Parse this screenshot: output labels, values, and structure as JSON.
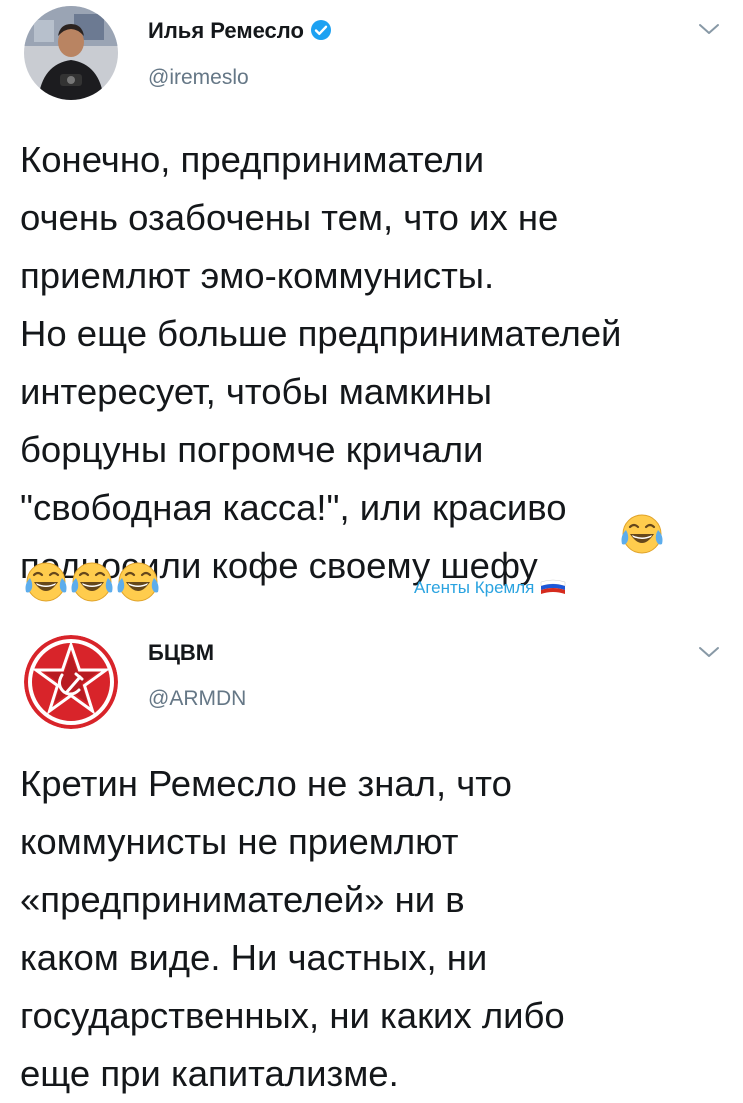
{
  "tweet1": {
    "author_name": "Илья Ремесло",
    "author_handle": "@iremeslo",
    "text": "Конечно, предприниматели\nочень озабочены тем, что их не\nприемлют эмо-коммунисты.\nНо еще больше предпринимателей\nинтересует, чтобы мамкины\nборцуны погромче кричали\n\"свободная касса!\", или красиво\nподносили кофе своему шефу",
    "emoji": "face-with-tears-of-joy",
    "emoji_count": 4,
    "signature": "Агенты Кремля",
    "signature_icon": "russian-flag-icon"
  },
  "tweet2": {
    "author_name": "БЦВМ",
    "author_handle": "@ARMDN",
    "text": "Кретин Ремесло не знал, что\nкоммунисты не приемлют\n«предпринимателей» ни в\nкаком виде. Ни частных, ни\nгосударственных, ни каких либо\nеще при капитализме."
  },
  "colors": {
    "text": "#14171a",
    "secondary": "#657786",
    "verified": "#1da1f2",
    "signature": "#2aa3e0",
    "logo_red": "#d8242a"
  }
}
